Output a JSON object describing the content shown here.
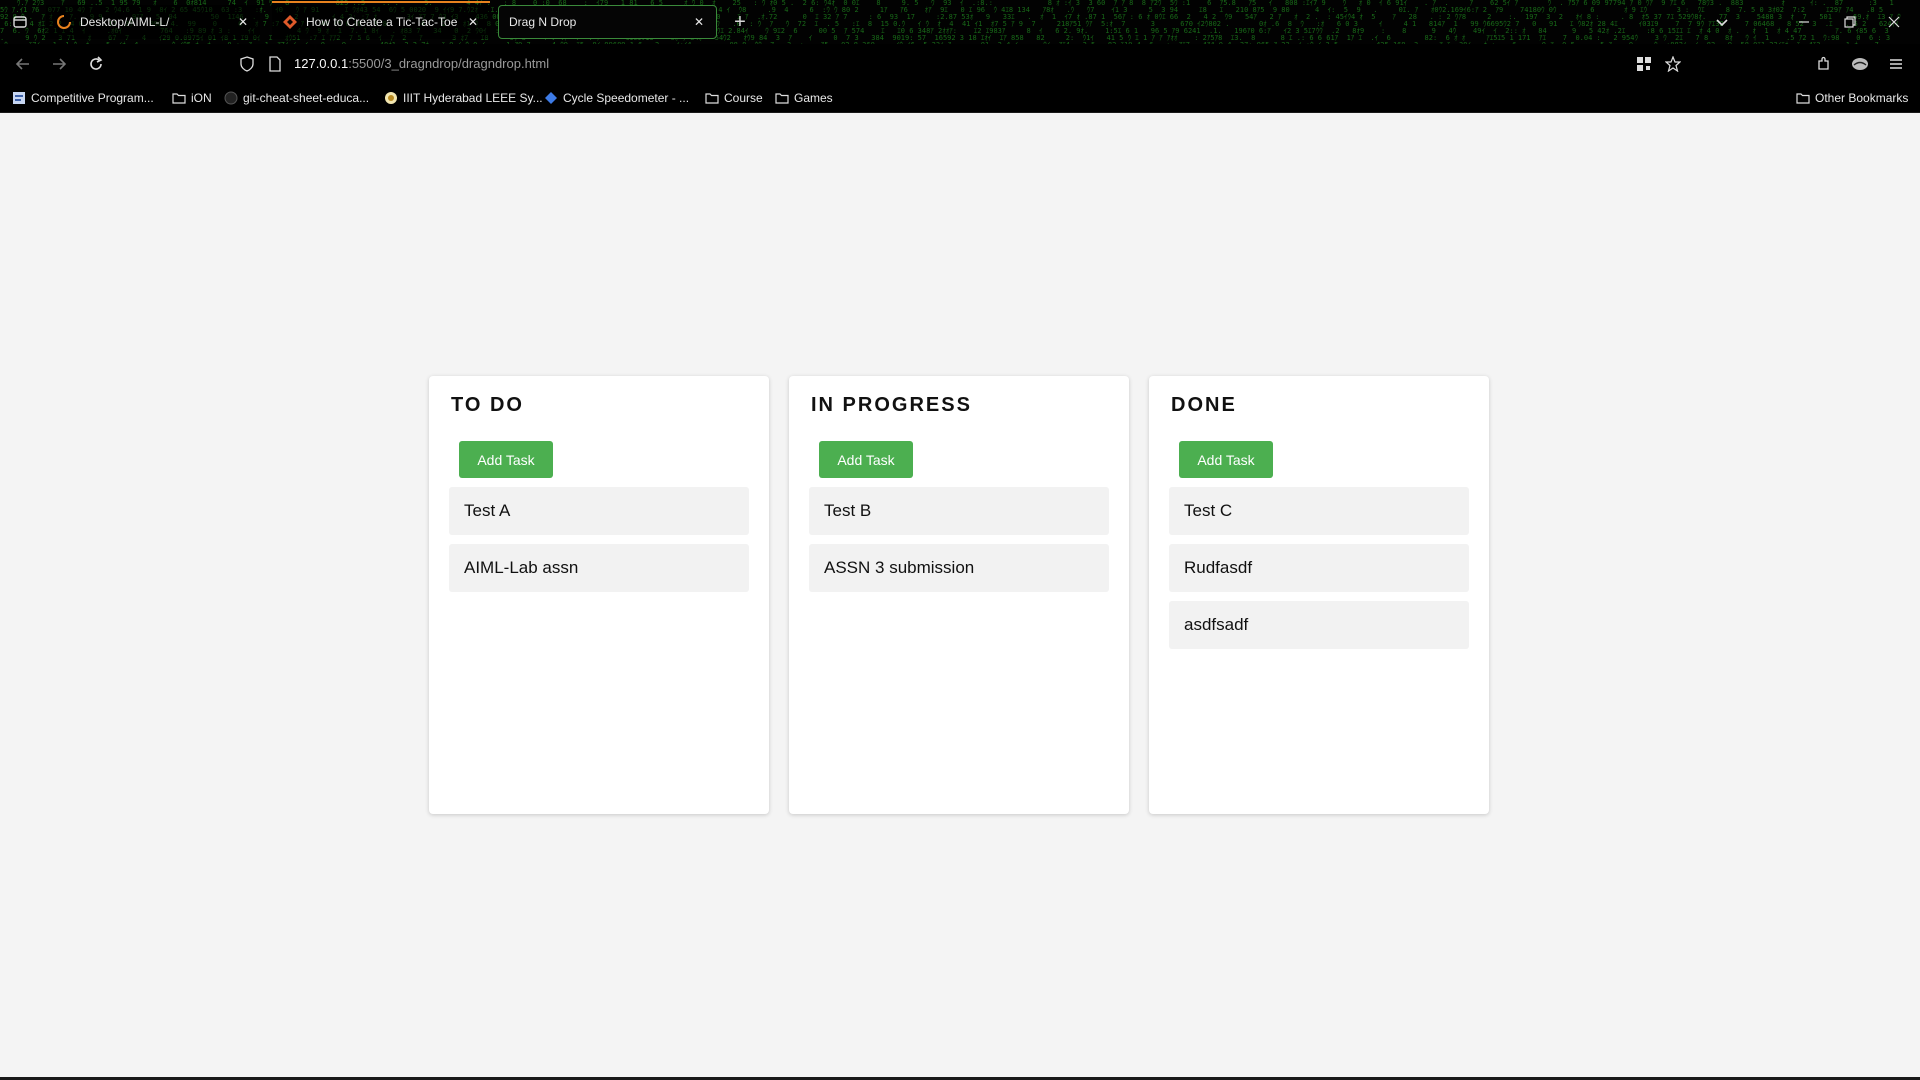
{
  "browser": {
    "tabs": [
      {
        "title": "Desktop/AIML-L/",
        "icon": "loading-spinner-icon"
      },
      {
        "title": "How to Create a Tic-Tac-Toe G",
        "icon": "geeksforgeeks-icon"
      },
      {
        "title": "Drag N Drop",
        "icon": "none",
        "active": true
      }
    ],
    "address": {
      "host": "127.0.0.1",
      "rest": ":5500/3_dragndrop/dragndrop.html"
    },
    "bookmarks": [
      {
        "label": "Competitive Program...",
        "icon": "site-icon"
      },
      {
        "label": "iON",
        "icon": "folder-icon"
      },
      {
        "label": "git-cheat-sheet-educa...",
        "icon": "github-icon"
      },
      {
        "label": "IIIT Hyderabad LEEE Sy...",
        "icon": "site-icon"
      },
      {
        "label": "Cycle Speedometer - ...",
        "icon": "diamond-icon"
      },
      {
        "label": "Course",
        "icon": "folder-icon"
      },
      {
        "label": "Games",
        "icon": "folder-icon"
      }
    ],
    "other_bookmarks": "Other Bookmarks"
  },
  "board": {
    "columns": [
      {
        "title": "TO DO",
        "add_label": "Add Task",
        "tasks": [
          "Test A",
          "AIML-Lab assn"
        ]
      },
      {
        "title": "IN PROGRESS",
        "add_label": "Add Task",
        "tasks": [
          "Test B",
          "ASSN 3 submission"
        ]
      },
      {
        "title": "DONE",
        "add_label": "Add Task",
        "tasks": [
          "Test C",
          "Rudfasdf",
          "asdfsadf"
        ]
      }
    ]
  },
  "colors": {
    "accent": "#4caf50",
    "page_bg": "#f4f4f4",
    "task_bg": "#f2f2f2"
  }
}
